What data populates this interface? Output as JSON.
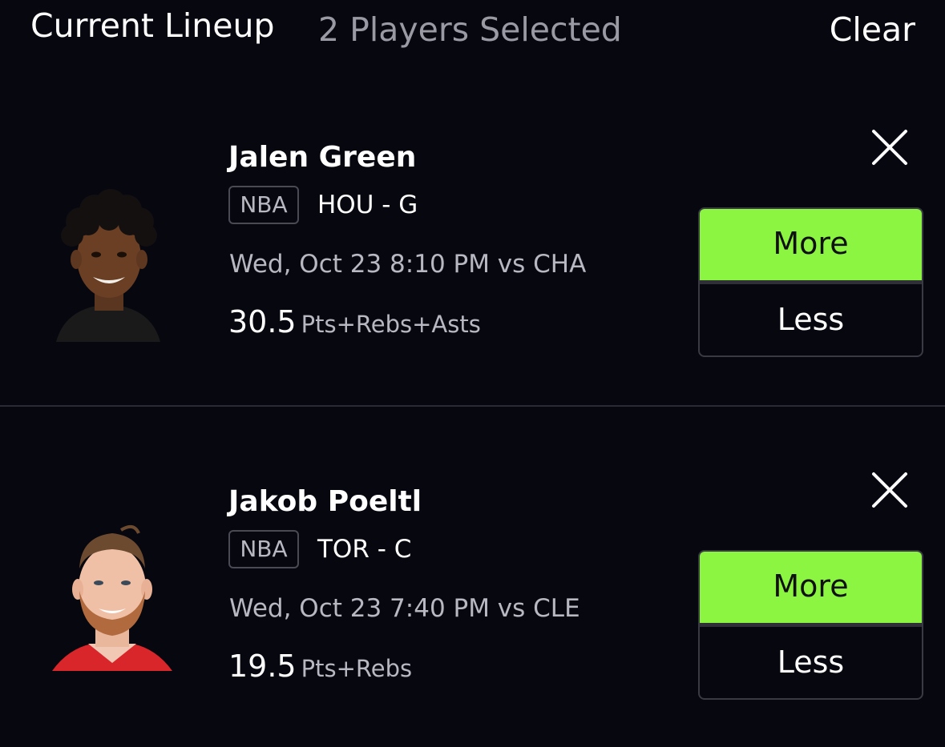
{
  "header": {
    "title": "Current Lineup",
    "count": "2 Players Selected",
    "clear_label": "Clear"
  },
  "players": [
    {
      "name": "Jalen Green",
      "league": "NBA",
      "team_position": "HOU - G",
      "game": "Wed, Oct 23 8:10 PM vs CHA",
      "line_value": "30.5",
      "line_stat": "Pts+Rebs+Asts",
      "more_label": "More",
      "less_label": "Less",
      "selected": "More",
      "remove_icon": "close-icon"
    },
    {
      "name": "Jakob Poeltl",
      "league": "NBA",
      "team_position": "TOR - C",
      "game": "Wed, Oct 23 7:40 PM vs CLE",
      "line_value": "19.5",
      "line_stat": "Pts+Rebs",
      "more_label": "More",
      "less_label": "Less",
      "selected": "More",
      "remove_icon": "close-icon"
    }
  ],
  "colors": {
    "background": "#07070f",
    "selected": "#8cf542",
    "muted_text": "#b8b8c2",
    "border": "#3a3a44"
  }
}
